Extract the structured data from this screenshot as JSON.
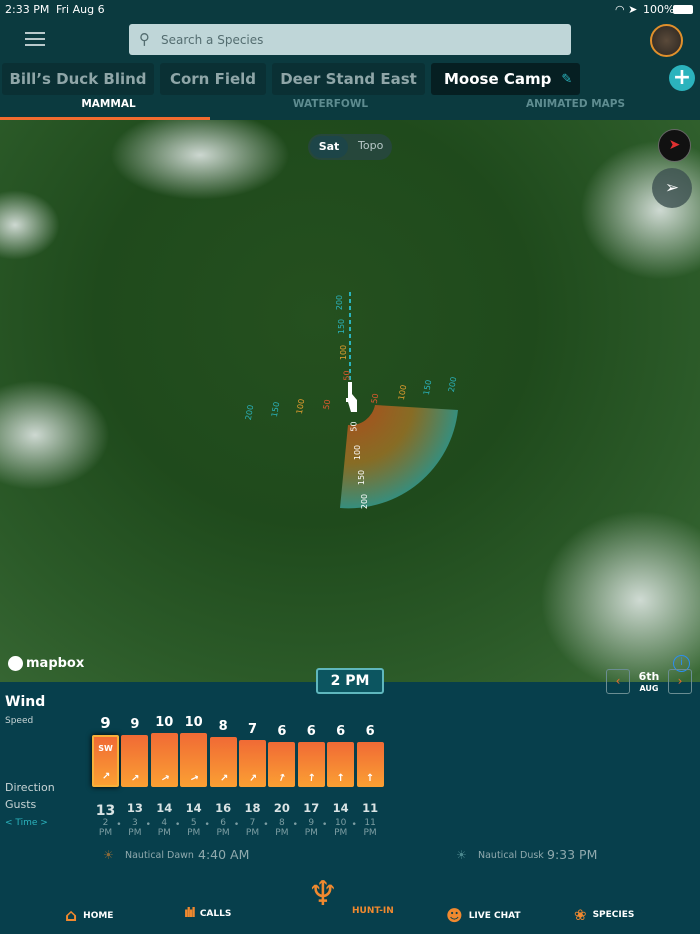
{
  "status": {
    "time": "2:33 PM",
    "date": "Fri Aug 6",
    "battery": "100%"
  },
  "search": {
    "placeholder": "Search a Species"
  },
  "locations": [
    "Bill’s Duck Blind",
    "Corn Field",
    "Deer Stand East",
    "Moose Camp"
  ],
  "categories": [
    "MAMMAL",
    "WATERFOWL",
    "ANIMATED MAPS"
  ],
  "map": {
    "toggle": [
      "Sat",
      "Topo"
    ],
    "attribution": "mapbox",
    "time_badge": "2 PM",
    "range_labels": [
      "200",
      "150",
      "100",
      "50"
    ],
    "wedge_labels": [
      "50",
      "100",
      "150",
      "200"
    ]
  },
  "date": {
    "day": "6th",
    "month": "AUG"
  },
  "wind": {
    "title": "Wind",
    "speed_label": "Speed",
    "direction_label": "Direction",
    "gusts_label": "Gusts",
    "time_label": "< Time >",
    "selected_direction": "SW",
    "hours": [
      {
        "speed": 9,
        "gust": 13,
        "time": [
          "2",
          "PM"
        ],
        "dir": 45
      },
      {
        "speed": 9,
        "gust": 13,
        "time": [
          "3",
          "PM"
        ],
        "dir": 50
      },
      {
        "speed": 10,
        "gust": 14,
        "time": [
          "4",
          "PM"
        ],
        "dir": 60
      },
      {
        "speed": 10,
        "gust": 14,
        "time": [
          "5",
          "PM"
        ],
        "dir": 65
      },
      {
        "speed": 8,
        "gust": 16,
        "time": [
          "6",
          "PM"
        ],
        "dir": 45
      },
      {
        "speed": 7,
        "gust": 18,
        "time": [
          "7",
          "PM"
        ],
        "dir": 40
      },
      {
        "speed": 6,
        "gust": 20,
        "time": [
          "8",
          "PM"
        ],
        "dir": 20
      },
      {
        "speed": 6,
        "gust": 17,
        "time": [
          "9",
          "PM"
        ],
        "dir": 5
      },
      {
        "speed": 6,
        "gust": 14,
        "time": [
          "10",
          "PM"
        ],
        "dir": 0
      },
      {
        "speed": 6,
        "gust": 11,
        "time": [
          "11",
          "PM"
        ],
        "dir": 0
      }
    ]
  },
  "sun": {
    "dawn_label": "Nautical Dawn",
    "dawn_time": "4:40 AM",
    "dusk_label": "Nautical Dusk",
    "dusk_time": "9:33 PM"
  },
  "nav": [
    "HOME",
    "CALLS",
    "HUNT-IN",
    "LIVE CHAT",
    "SPECIES"
  ],
  "colors": {
    "accent": "#f26b2f",
    "teal": "#2bb3bd",
    "panel": "#073f4c"
  }
}
